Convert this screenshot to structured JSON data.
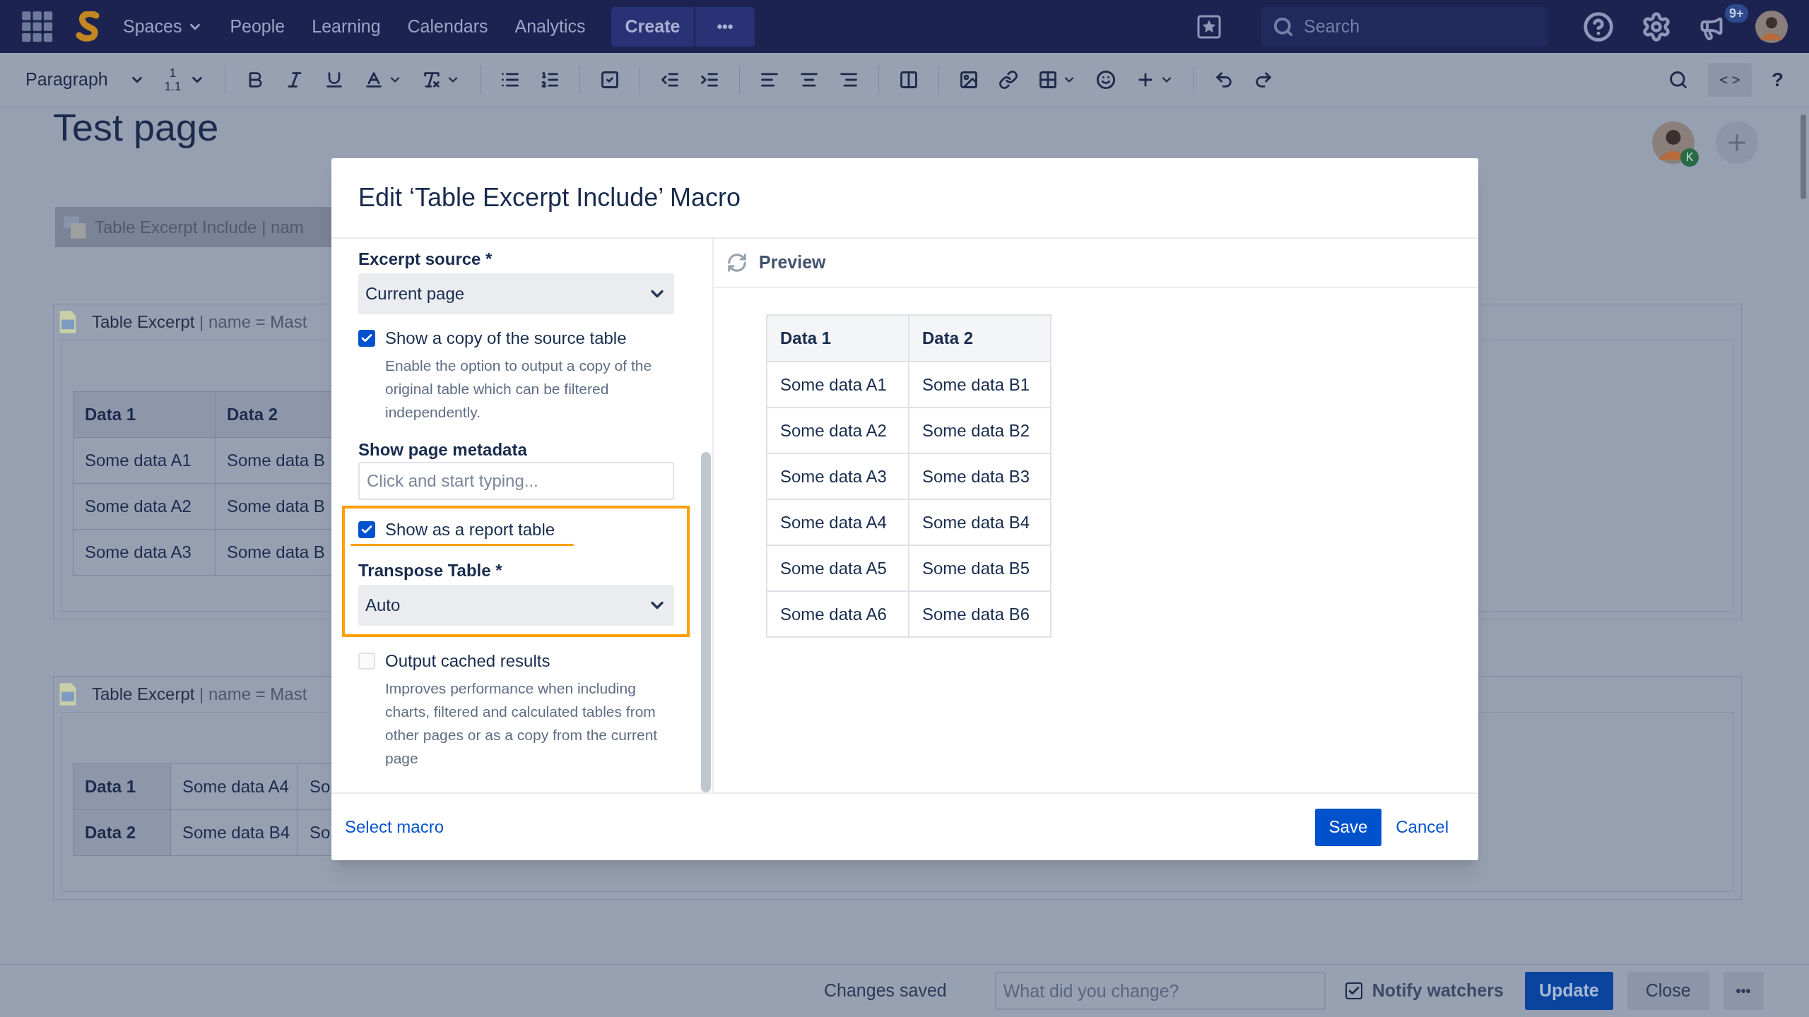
{
  "nav": {
    "items": [
      {
        "label": "Spaces",
        "dropdown": true
      },
      {
        "label": "People",
        "dropdown": false
      },
      {
        "label": "Learning",
        "dropdown": false
      },
      {
        "label": "Calendars",
        "dropdown": false
      },
      {
        "label": "Analytics",
        "dropdown": false
      }
    ],
    "create": "Create",
    "more": "•••",
    "search_placeholder": "Search",
    "notification_badge": "9+"
  },
  "toolbar": {
    "style": "Paragraph",
    "heading_numbers": [
      "1",
      "1.1"
    ],
    "code_label": "< >",
    "help_label": "?"
  },
  "page": {
    "title": "Test page",
    "collaborator_badge": "K",
    "macros": [
      {
        "kind": "include",
        "title": "Table Excerpt Include",
        "params": "| nam"
      },
      {
        "kind": "excerpt",
        "title": "Table Excerpt",
        "params": "| name = Mast",
        "table": {
          "rows": [
            [
              {
                "text": "Data 1",
                "header": true
              },
              {
                "text": "Data 2",
                "header": true
              }
            ],
            [
              {
                "text": "Some data A1",
                "header": false
              },
              {
                "text": "Some data B",
                "header": false
              }
            ],
            [
              {
                "text": "Some data A2",
                "header": false
              },
              {
                "text": "Some data B",
                "header": false
              }
            ],
            [
              {
                "text": "Some data A3",
                "header": false
              },
              {
                "text": "Some data B",
                "header": false
              }
            ]
          ]
        }
      },
      {
        "kind": "excerpt",
        "title": "Table Excerpt",
        "params": "| name = Mast",
        "table": {
          "rows": [
            [
              {
                "text": "Data 1",
                "header": true
              },
              {
                "text": "Some data A4",
                "header": false
              },
              {
                "text": "So",
                "header": false
              }
            ],
            [
              {
                "text": "Data 2",
                "header": true
              },
              {
                "text": "Some data B4",
                "header": false
              },
              {
                "text": "So",
                "header": false
              }
            ]
          ]
        }
      }
    ]
  },
  "dialog": {
    "title": "Edit ‘Table Excerpt Include’ Macro",
    "fields": [
      {
        "kind": "select",
        "label": "Excerpt source *",
        "value": "Current page"
      },
      {
        "kind": "checkbox",
        "label": "Show a copy of the source table",
        "checked": true,
        "description": "Enable the option to output a copy of the original table which can be filtered independently."
      },
      {
        "kind": "text",
        "label": "Show page metadata",
        "placeholder": "Click and start typing..."
      },
      {
        "kind": "highlight_group",
        "children": [
          {
            "kind": "checkbox",
            "label": "Show as a report table",
            "checked": true,
            "underlined": true
          },
          {
            "kind": "select",
            "label": "Transpose Table *",
            "value": "Auto"
          }
        ]
      },
      {
        "kind": "checkbox",
        "label": "Output cached results",
        "checked": false,
        "description": "Improves performance when including charts, filtered and calculated tables from other pages or as a copy from the current page"
      }
    ],
    "preview": {
      "title": "Preview",
      "columns": [
        "Data 1",
        "Data 2"
      ],
      "rows": [
        [
          "Some data A1",
          "Some data B1"
        ],
        [
          "Some data A2",
          "Some data B2"
        ],
        [
          "Some data A3",
          "Some data B3"
        ],
        [
          "Some data A4",
          "Some data B4"
        ],
        [
          "Some data A5",
          "Some data B5"
        ],
        [
          "Some data A6",
          "Some data B6"
        ]
      ]
    },
    "select_macro": "Select macro",
    "save": "Save",
    "cancel": "Cancel"
  },
  "bottom_bar": {
    "status": "Changes saved",
    "comment_placeholder": "What did you change?",
    "notify": {
      "label": "Notify watchers",
      "checked": true
    },
    "update": "Update",
    "close": "Close",
    "more": "•••"
  }
}
